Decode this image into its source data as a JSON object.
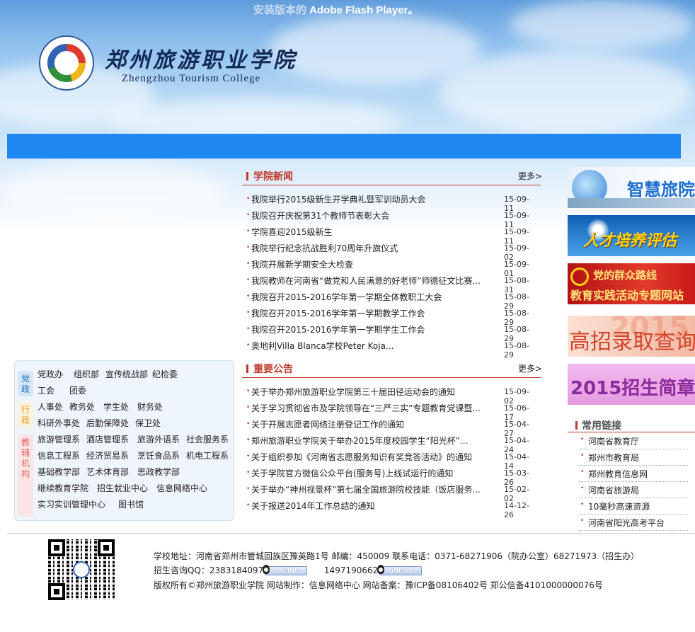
{
  "flash_notice": {
    "dim": "安装版本的",
    "text": " Adobe Flash Player。"
  },
  "header": {
    "name_cn": "郑州旅游职业学院",
    "name_en": "Zhengzhou Tourism College"
  },
  "left_panel": {
    "categories": [
      {
        "label": "党政",
        "color": "#1d6fc3"
      },
      {
        "label": "行政",
        "color": "#e3a21a"
      },
      {
        "label": "教辅机构",
        "color": "#e06767"
      }
    ],
    "rows": [
      [
        "党政办",
        "组织部",
        "宣传统战部",
        "纪检委"
      ],
      [
        "工会",
        "团委"
      ],
      [
        "人事处",
        "教务处",
        "学生处",
        "财务处"
      ],
      [
        "科研外事处",
        "后勤保障处",
        "保卫处"
      ],
      [
        "旅游管理系",
        "酒店管理系",
        "旅游外语系",
        "社会服务系"
      ],
      [
        "信息工程系",
        "经济贸易系",
        "烹饪食品系",
        "机电工程系"
      ],
      [
        "基础教学部",
        "艺术体育部",
        "思政教学部"
      ],
      [
        "继续教育学院",
        "招生就业中心",
        "信息网络中心"
      ],
      [
        "实习实训管理中心",
        "图书馆"
      ]
    ]
  },
  "news": {
    "title": "学院新闻",
    "more": "更多>",
    "items": [
      {
        "title": "我院举行2015级新生开学典礼暨军训动员大会",
        "date": "15-09-11"
      },
      {
        "title": "我院召开庆祝第31个教师节表彰大会",
        "date": "15-09-11"
      },
      {
        "title": "学院喜迎2015级新生",
        "date": "15-09-11"
      },
      {
        "title": "我院举行纪念抗战胜利70周年升旗仪式",
        "date": "15-09-02"
      },
      {
        "title": "我院开展新学期安全大检查",
        "date": "15-09-01"
      },
      {
        "title": "我院教师在河南省“做党和人民满意的好老师”师德征文比赛...",
        "date": "15-08-31"
      },
      {
        "title": "我院召开2015-2016学年第一学期全体教职工大会",
        "date": "15-08-29"
      },
      {
        "title": "我院召开2015-2016学年第一学期教学工作会",
        "date": "15-08-29"
      },
      {
        "title": "我院召开2015-2016学年第一学期学生工作会",
        "date": "15-08-29"
      },
      {
        "title": "奥地利Villa Blanca学校Peter Koja...",
        "date": "15-08-29"
      }
    ]
  },
  "notices": {
    "title": "重要公告",
    "more": "更多>",
    "items": [
      {
        "title": "关于举办郑州旅游职业学院第三十届田径运动会的通知",
        "date": "15-09-02"
      },
      {
        "title": "关于学习贯彻省市及学院领导在“三严三实”专题教育党课暨...",
        "date": "15-06-17"
      },
      {
        "title": "关于开展志愿者网络注册登记工作的通知",
        "date": "15-04-27"
      },
      {
        "title": "郑州旅游职业学院关于举办2015年度校园学生“阳光杯”...",
        "date": "15-04-24"
      },
      {
        "title": "关于组织参加《河南省志愿服务知识有奖竞答活动》的通知",
        "date": "15-04-14"
      },
      {
        "title": "关于学院官方微信公众平台(服务号)上线试运行的通知",
        "date": "15-03-26"
      },
      {
        "title": "关于举办“神州视景杯”第七届全国旅游院校技能（饭店服务...",
        "date": "15-02-02"
      },
      {
        "title": "关于报送2014年工作总结的通知",
        "date": "14-12-26"
      }
    ]
  },
  "banners": [
    {
      "text": "智慧旅院"
    },
    {
      "text": "人才培养评估"
    },
    {
      "text": "党的群众路线",
      "text2": "教育实践活动专题网站"
    },
    {
      "text": "高招录取查询"
    },
    {
      "text": "2015招生简章"
    }
  ],
  "links": {
    "title": "常用链接",
    "items": [
      "河南省教育厅",
      "郑州市教育局",
      "郑州教育信息网",
      "河南省旅游局",
      "10毫秒高速资源",
      "河南省阳光高考平台"
    ]
  },
  "footer": {
    "line1": "学校地址：河南省郑州市管城回族区豫英路1号   邮编：450009   联系电话：0371-68271906（院办公室）68271973（招生办）",
    "qq_label": "招生咨询QQ：",
    "qq1": "2383184097",
    "qq2": "1497190662",
    "online": "ONLINE",
    "line3": "版权所有©郑州旅游职业学院   网站制作：信息网络中心 网站备案：豫ICP备08106402号 郑公信备4101000000076号"
  }
}
